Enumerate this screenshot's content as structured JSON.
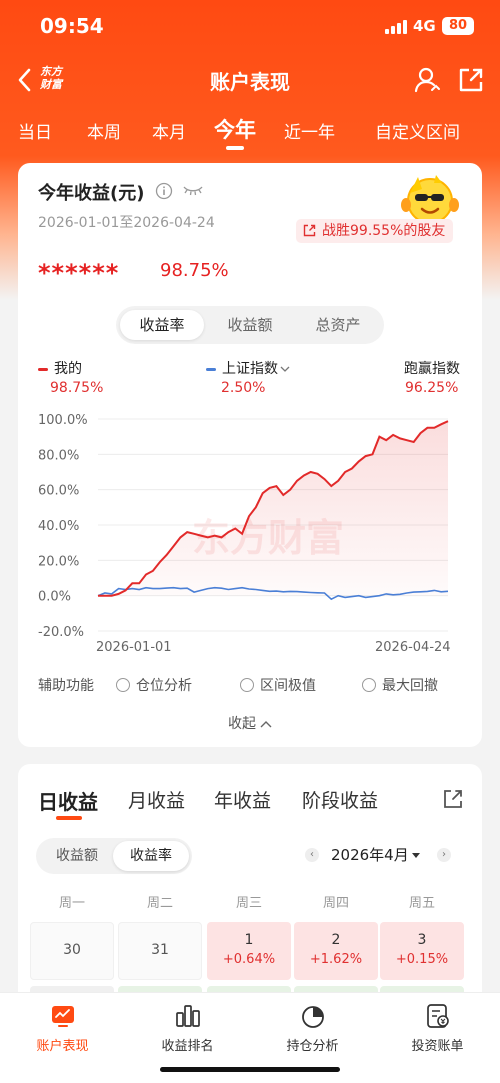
{
  "status_bar": {
    "time": "09:54",
    "network": "4G",
    "battery": "80"
  },
  "nav": {
    "logo_line1": "东方",
    "logo_line2": "财富",
    "title": "账户表现"
  },
  "period_tabs": [
    "当日",
    "本周",
    "本月",
    "今年",
    "近一年",
    "自定义区间"
  ],
  "active_period": "今年",
  "summary": {
    "title": "今年收益(元)",
    "date_range": "2026-01-01至2026-04-24",
    "beat_text": "战胜99.55%的股友",
    "hidden_amount": "******",
    "return_pct": "98.75%"
  },
  "metric_tabs": [
    "收益率",
    "收益额",
    "总资产"
  ],
  "active_metric": "收益率",
  "legend": {
    "mine_label": "我的",
    "mine_pct": "98.75%",
    "index_label": "上证指数",
    "index_pct": "2.50%",
    "outperf_label": "跑赢指数",
    "outperf_pct": "96.25%"
  },
  "colors": {
    "brand": "#ff4a12",
    "up": "#e03030",
    "mine_line": "#e22a2a",
    "index_line": "#4a7fd6"
  },
  "chart_data": {
    "type": "line",
    "x_start": "2026-01-01",
    "x_end": "2026-04-24",
    "x_tick_labels": [
      "2026-01-01",
      "2026-04-24"
    ],
    "y_tick_labels": [
      "100.0%",
      "80.0%",
      "60.0%",
      "40.0%",
      "20.0%",
      "0.0%",
      "-20.0%"
    ],
    "ylim": [
      -20,
      100
    ],
    "watermark": "东方财富",
    "series": [
      {
        "name": "我的",
        "values": [
          0,
          0,
          0,
          1,
          3,
          7,
          7,
          12,
          14,
          19,
          23,
          28,
          33,
          36,
          35,
          34,
          33,
          34,
          33,
          36,
          38,
          35,
          45,
          50,
          58,
          61,
          62,
          57,
          60,
          65,
          68,
          70,
          69,
          66,
          62,
          65,
          70,
          72,
          76,
          79,
          80,
          90,
          88,
          91,
          89,
          88,
          87,
          92,
          95,
          95,
          97,
          98.75
        ]
      },
      {
        "name": "上证指数",
        "values": [
          0,
          1.5,
          1,
          4,
          3.5,
          4,
          3.5,
          4.5,
          4,
          4,
          4.3,
          4.5,
          4,
          4.2,
          2,
          3,
          4,
          4.5,
          4.2,
          3.5,
          4,
          4.5,
          3.8,
          3.5,
          3,
          2.5,
          2.6,
          2.2,
          2.4,
          2.3,
          2,
          1.8,
          1.6,
          1.5,
          -2,
          0,
          -1,
          -0.5,
          0,
          -1,
          -0.5,
          0,
          1,
          0.5,
          0.8,
          1.5,
          2,
          2.2,
          2.4,
          3,
          2.2,
          2.5
        ]
      }
    ]
  },
  "aux": {
    "label": "辅助功能",
    "options": [
      "仓位分析",
      "区间极值",
      "最大回撤"
    ],
    "collapse": "收起"
  },
  "daily": {
    "tabs": [
      "日收益",
      "月收益",
      "年收益",
      "阶段收益"
    ],
    "active_tab": "日收益",
    "mode_tabs": [
      "收益额",
      "收益率"
    ],
    "active_mode": "收益率",
    "month": "2026年4月",
    "weekdays": [
      "周一",
      "周二",
      "周三",
      "周四",
      "周五"
    ],
    "days": [
      {
        "day": "30",
        "pct": ""
      },
      {
        "day": "31",
        "pct": ""
      },
      {
        "day": "1",
        "pct": "+0.64%"
      },
      {
        "day": "2",
        "pct": "+1.62%"
      },
      {
        "day": "3",
        "pct": "+0.15%"
      }
    ]
  },
  "bottom_tabs": [
    "账户表现",
    "收益排名",
    "持仓分析",
    "投资账单"
  ]
}
